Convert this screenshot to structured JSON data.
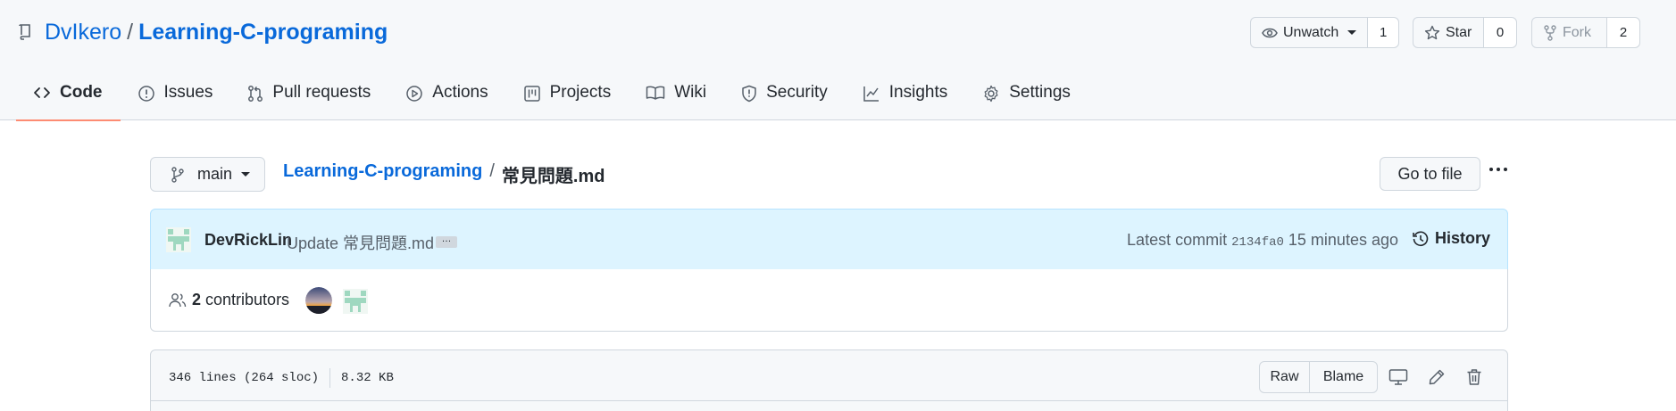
{
  "repo": {
    "owner": "DvIkero",
    "separator": "/",
    "name": "Learning-C-programing"
  },
  "header_actions": {
    "watch_label": "Unwatch",
    "watch_count": "1",
    "star_label": "Star",
    "star_count": "0",
    "fork_label": "Fork",
    "fork_count": "2"
  },
  "tabs": [
    {
      "label": "Code",
      "icon": "code-icon",
      "selected": true
    },
    {
      "label": "Issues",
      "icon": "issue-icon"
    },
    {
      "label": "Pull requests",
      "icon": "pull-request-icon"
    },
    {
      "label": "Actions",
      "icon": "play-icon"
    },
    {
      "label": "Projects",
      "icon": "project-icon"
    },
    {
      "label": "Wiki",
      "icon": "book-icon"
    },
    {
      "label": "Security",
      "icon": "shield-icon"
    },
    {
      "label": "Insights",
      "icon": "graph-icon"
    },
    {
      "label": "Settings",
      "icon": "gear-icon"
    }
  ],
  "file_nav": {
    "branch": "main",
    "repo_link": "Learning-C-programing",
    "separator": "/",
    "file_name": "常見問題.md",
    "go_to_file": "Go to file"
  },
  "commit": {
    "author": "DevRickLin",
    "message": "Update 常見問題.md",
    "ellipsis": "…",
    "latest_label": "Latest commit",
    "sha": "2134fa0",
    "time": "15 minutes ago",
    "history_label": "History"
  },
  "contributors": {
    "count": "2",
    "label": "contributors"
  },
  "file_info": {
    "lines": "346 lines (264 sloc)",
    "size": "8.32 KB",
    "raw_label": "Raw",
    "blame_label": "Blame"
  },
  "colors": {
    "link": "#0969da",
    "tab_underline": "#fd8c73",
    "commit_bg": "#ddf4ff",
    "border": "#d0d7de"
  }
}
